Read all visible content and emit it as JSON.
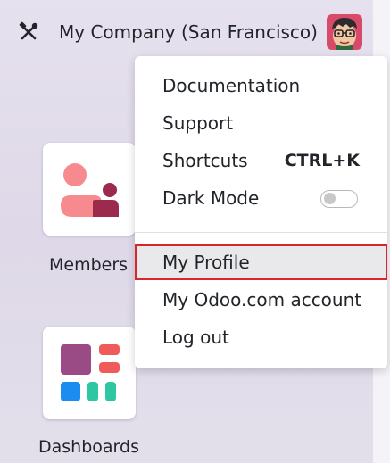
{
  "topbar": {
    "company_name": "My Company (San Francisco)",
    "settings_icon": "tools-icon",
    "avatar_icon": "user-avatar"
  },
  "apps": [
    {
      "label": "Members",
      "icon": "members-icon"
    },
    {
      "label": "Dashboards",
      "icon": "dashboards-icon"
    }
  ],
  "user_menu": {
    "items": [
      {
        "label": "Documentation"
      },
      {
        "label": "Support"
      },
      {
        "label": "Shortcuts",
        "shortcut": "CTRL+K"
      },
      {
        "label": "Dark Mode",
        "toggle": false
      },
      {
        "label": "My Profile",
        "highlighted": true
      },
      {
        "label": "My Odoo.com account"
      },
      {
        "label": "Log out"
      }
    ]
  },
  "colors": {
    "highlight_border": "#d9262a",
    "members_pink": "#f78a8f",
    "members_plum": "#9b2a4d",
    "dash_purple": "#9a4b86",
    "dash_red": "#f05a5b",
    "dash_blue": "#1d8cf0",
    "dash_teal": "#2ec7a4"
  }
}
